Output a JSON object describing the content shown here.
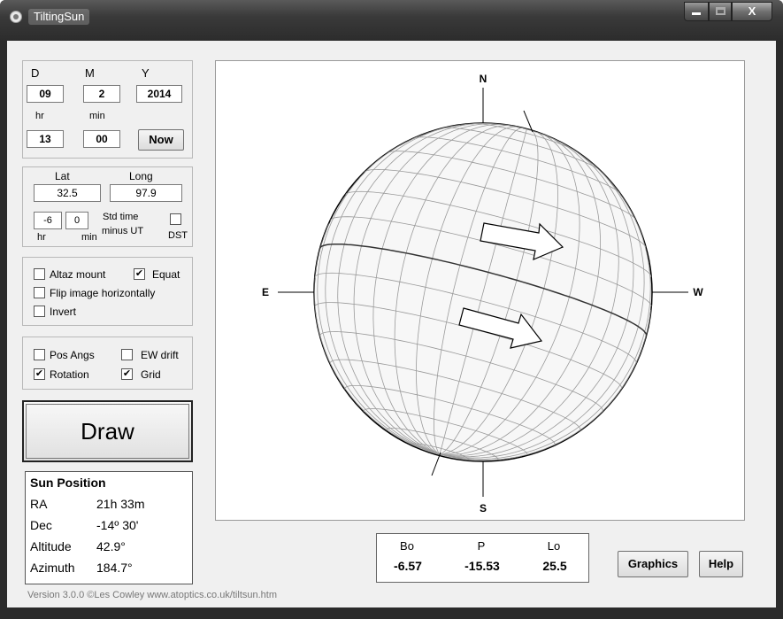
{
  "window": {
    "title": "TiltingSun",
    "close_label": "X"
  },
  "datetime": {
    "day_label": "D",
    "month_label": "M",
    "year_label": "Y",
    "day": "09",
    "month": "2",
    "year": "2014",
    "hr_label": "hr",
    "min_label": "min",
    "hour": "13",
    "minute": "00",
    "now_label": "Now"
  },
  "location": {
    "lat_label": "Lat",
    "long_label": "Long",
    "lat": "32.5",
    "long": "97.9",
    "tz_hr": "-6",
    "tz_min": "0",
    "hr_label": "hr",
    "min_label": "min",
    "std_time_label": "Std time",
    "minus_ut_label": "minus UT",
    "dst_label": "DST",
    "dst_checked": false
  },
  "mount": {
    "altaz_label": "Altaz mount",
    "altaz_checked": false,
    "equat_label": "Equat",
    "equat_checked": true,
    "flip_label": "Flip image horizontally",
    "flip_checked": false,
    "invert_label": "Invert",
    "invert_checked": false
  },
  "overlays": {
    "posangs_label": "Pos Angs",
    "posangs_checked": false,
    "ewdrift_label": "EW drift",
    "ewdrift_checked": false,
    "rotation_label": "Rotation",
    "rotation_checked": true,
    "grid_label": "Grid",
    "grid_checked": true
  },
  "draw_label": "Draw",
  "sun_position": {
    "title": "Sun Position",
    "ra_label": "RA",
    "ra": "21h 33m",
    "dec_label": "Dec",
    "dec": "-14º 30'",
    "alt_label": "Altitude",
    "alt": "42.9°",
    "az_label": "Azimuth",
    "az": "184.7°"
  },
  "compass": {
    "n": "N",
    "s": "S",
    "e": "E",
    "w": "W"
  },
  "solar": {
    "bo_label": "Bo",
    "bo": "-6.57",
    "p_label": "P",
    "p": "-15.53",
    "lo_label": "Lo",
    "lo": "25.5"
  },
  "graphics_label": "Graphics",
  "help_label": "Help",
  "version_text": "Version 3.0.0  ©Les Cowley www.atoptics.co.uk/tiltsun.htm"
}
